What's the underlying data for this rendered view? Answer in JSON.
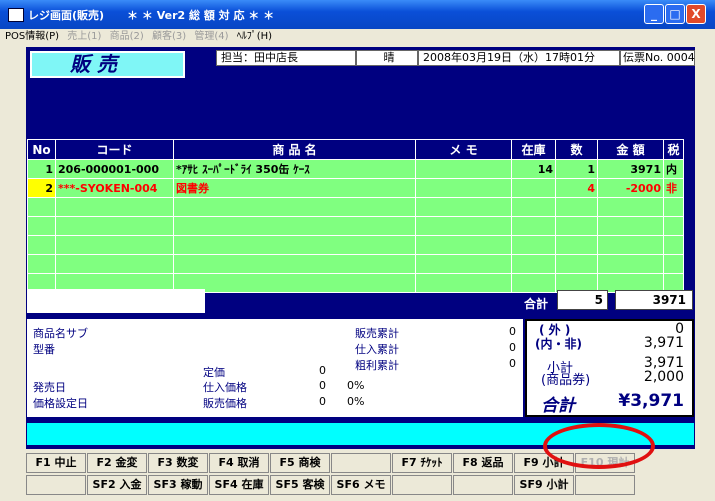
{
  "window": {
    "title": "レジ画面(販売)",
    "subtitle": "＊ ＊ Ver2 総 額 対 応 ＊ ＊",
    "controls": [
      "_",
      "□",
      "X"
    ]
  },
  "menu": [
    {
      "label": "POS情報(P)",
      "enabled": true
    },
    {
      "label": "売上(1)",
      "enabled": false
    },
    {
      "label": "商品(2)",
      "enabled": false
    },
    {
      "label": "顧客(3)",
      "enabled": false
    },
    {
      "label": "管理(4)",
      "enabled": false
    },
    {
      "label": "ﾍﾙﾌﾟ(H)",
      "enabled": true
    }
  ],
  "header": {
    "mode": "販 売",
    "staff": "担当：田中店長",
    "weather": "晴",
    "datetime": "2008年03月19日（水）17時01分",
    "slip_label": "伝票No.",
    "slip_no": "0004"
  },
  "grid": {
    "columns": [
      "No",
      "コード",
      "商 品 名",
      "メ モ",
      "在庫",
      "数",
      "金 額",
      "税"
    ],
    "rows": [
      {
        "no": "1",
        "code": "206-000001-000",
        "name": "*ｱｻﾋ ｽｰﾊﾟｰﾄﾞﾗｲ 350缶 ｹｰｽ",
        "memo": "",
        "stock": "14",
        "qty": "1",
        "amount": "3971",
        "tax": "内"
      },
      {
        "no": "2",
        "code": "***-SYOKEN-004",
        "name": "図書券",
        "memo": "",
        "stock": "",
        "qty": "4",
        "amount": "-2000",
        "tax": "非"
      }
    ]
  },
  "summary": {
    "total_label": "合計",
    "count": "5",
    "amount": "3971"
  },
  "info": {
    "product_sub_label": "商品名サブ",
    "model_label": "型番",
    "list_price_label": "定価",
    "list_price": "0",
    "release_label": "発売日",
    "purchase_price_label": "仕入価格",
    "purchase_price": "0",
    "purchase_pct": "0%",
    "price_date_label": "価格設定日",
    "sale_price_label": "販売価格",
    "sale_price": "0",
    "sale_pct": "0%",
    "sales_total_label": "販売累計",
    "sales_total": "0",
    "purchase_total_label": "仕入累計",
    "purchase_total": "0",
    "gross_total_label": "粗利累計",
    "gross_total": "0"
  },
  "totals": {
    "outer_label": "( 外 )",
    "outer_value": "0",
    "inner_label": "(内・非)",
    "inner_value": "3,971",
    "subtotal_label": "小計",
    "subtotal_value": "3,971",
    "voucher_label": "(商品券)",
    "voucher_value": "2,000",
    "grand_label": "合計",
    "grand_value": "¥3,971"
  },
  "function_keys_row1": [
    {
      "label": "F1 中止",
      "enabled": true
    },
    {
      "label": "F2 金変",
      "enabled": true
    },
    {
      "label": "F3 数変",
      "enabled": true
    },
    {
      "label": "F4 取消",
      "enabled": true
    },
    {
      "label": "F5 商検",
      "enabled": true
    },
    {
      "label": "",
      "enabled": true
    },
    {
      "label": "F7 ﾁｹｯﾄ",
      "enabled": true
    },
    {
      "label": "F8 返品",
      "enabled": true
    },
    {
      "label": "F9 小計",
      "enabled": true
    },
    {
      "label": "F10 現計",
      "enabled": false
    }
  ],
  "function_keys_row2": [
    {
      "label": "",
      "enabled": true
    },
    {
      "label": "SF2 入金",
      "enabled": true
    },
    {
      "label": "SF3 稼動",
      "enabled": true
    },
    {
      "label": "SF4 在庫",
      "enabled": true
    },
    {
      "label": "SF5 客検",
      "enabled": true
    },
    {
      "label": "SF6 メモ",
      "enabled": true
    },
    {
      "label": "",
      "enabled": true
    },
    {
      "label": "",
      "enabled": true
    },
    {
      "label": "SF9 小計",
      "enabled": true
    },
    {
      "label": "",
      "enabled": true
    }
  ],
  "colors": {
    "client_bg": "#000080",
    "grid_row": "#80ff80",
    "selected_cell": "#ffff00",
    "cyan": "#00ffff",
    "highlight_circle": "#e01010"
  }
}
